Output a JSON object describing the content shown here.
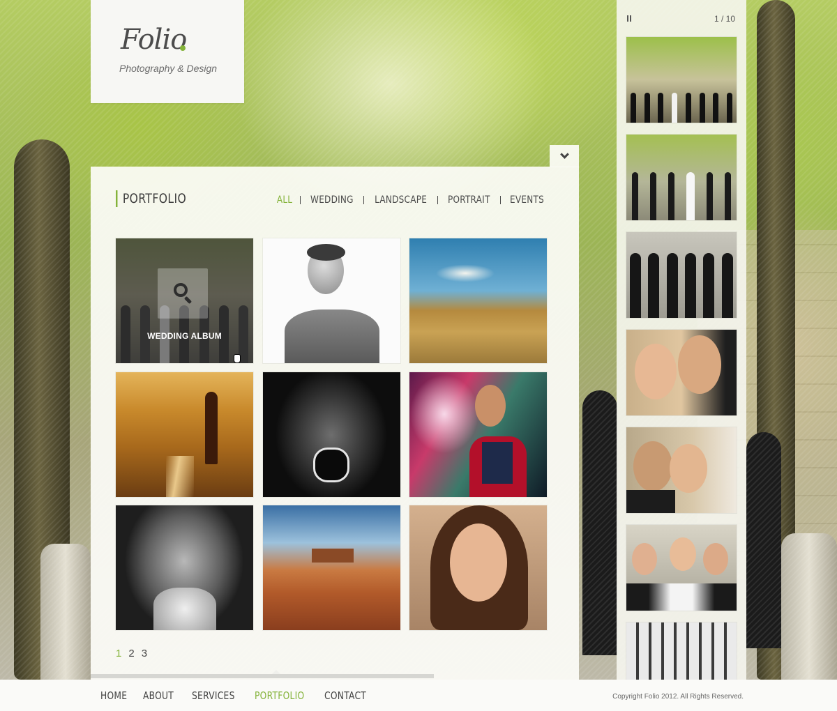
{
  "brand": {
    "name": "Folio",
    "tagline": "Photography & Design",
    "accent_color": "#84b33a"
  },
  "portfolio": {
    "title": "PORTFOLIO",
    "filters": [
      {
        "label": "ALL",
        "active": true
      },
      {
        "label": "WEDDING",
        "active": false
      },
      {
        "label": "LANDSCAPE",
        "active": false
      },
      {
        "label": "PORTRAIT",
        "active": false
      },
      {
        "label": "EVENTS",
        "active": false
      }
    ],
    "items": [
      {
        "subject": "wedding group",
        "caption": "WEDDING ALBUM",
        "hovered": true,
        "hover_icon": "search-icon"
      },
      {
        "subject": "black and white young man portrait"
      },
      {
        "subject": "golden hills landscape"
      },
      {
        "subject": "tuscany road and cypress"
      },
      {
        "subject": "screaming man close-up"
      },
      {
        "subject": "singer with guitar on stage"
      },
      {
        "subject": "elderly man black and white portrait"
      },
      {
        "subject": "desert valley landscape"
      },
      {
        "subject": "young woman portrait"
      }
    ],
    "pagination": [
      {
        "label": "1",
        "active": true
      },
      {
        "label": "2",
        "active": false
      },
      {
        "label": "3",
        "active": false
      }
    ]
  },
  "slideshow": {
    "counter": "1 / 10",
    "pause_icon": "pause-icon",
    "thumbnails": [
      "wedding party at cathedral gate",
      "bride and bridesmaids walking",
      "groomsmen in suits",
      "couple close-up smiling",
      "couple forehead to forehead",
      "bride laughing with bridesmaids",
      "typewriter keys"
    ]
  },
  "footer": {
    "nav": [
      {
        "label": "HOME",
        "active": false
      },
      {
        "label": "ABOUT",
        "active": false
      },
      {
        "label": "SERVICES",
        "active": false
      },
      {
        "label": "PORTFOLIO",
        "active": true
      },
      {
        "label": "CONTACT",
        "active": false
      }
    ],
    "copyright": "Copyright Folio 2012. All Rights Reserved."
  }
}
